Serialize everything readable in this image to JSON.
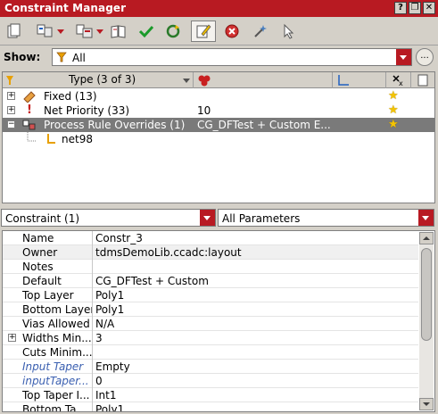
{
  "window": {
    "title": "Constraint Manager",
    "controls": [
      "?",
      "❐",
      "✕"
    ]
  },
  "toolbar": {
    "buttons": [
      {
        "name": "copy-icon"
      },
      {
        "name": "multi-copy-icon"
      },
      {
        "name": "layout-copy-icon"
      },
      {
        "name": "book-icon"
      },
      {
        "name": "check-icon"
      },
      {
        "name": "refresh-icon"
      },
      {
        "name": "edit-icon",
        "active": true
      },
      {
        "name": "stop-icon"
      },
      {
        "name": "wand-icon"
      },
      {
        "name": "pointer-icon"
      }
    ]
  },
  "show": {
    "label": "Show:",
    "value": "All",
    "more": "..."
  },
  "tree": {
    "header": {
      "type": "Type (3 of 3)"
    },
    "rows": [
      {
        "expander": "+",
        "label": "Fixed (13)",
        "value": "",
        "icon": "pin-icon",
        "star": true
      },
      {
        "expander": "+",
        "label": "Net Priority (33)",
        "value": "10",
        "icon": "exclamation-icon",
        "star": true
      },
      {
        "expander": "−",
        "label": "Process Rule Overrides (1)",
        "value": "CG_DFTest + Custom E...",
        "icon": "rule-icon",
        "star": true,
        "selected": true
      },
      {
        "expander": "",
        "label": "net98",
        "value": "",
        "icon": "net-icon",
        "star": false,
        "child": true
      }
    ]
  },
  "constraint_select": {
    "value": "Constraint (1)"
  },
  "param_select": {
    "value": "All Parameters"
  },
  "grid": {
    "rows": [
      {
        "key": "Name",
        "value": "Constr_3"
      },
      {
        "key": "Owner",
        "value": "tdmsDemoLib.ccadc:layout"
      },
      {
        "key": "Notes",
        "value": ""
      },
      {
        "key": "Default",
        "value": "CG_DFTest + Custom"
      },
      {
        "key": "Top Layer",
        "value": "Poly1"
      },
      {
        "key": "Bottom Layer",
        "value": "Poly1"
      },
      {
        "key": "Vias Allowed",
        "value": "N/A"
      },
      {
        "key": "Widths Min...",
        "value": "3",
        "expander": "+"
      },
      {
        "key": "Cuts Minim...",
        "value": ""
      },
      {
        "key": "Input Taper",
        "value": "Empty",
        "italic": true
      },
      {
        "key": "inputTaper...",
        "value": "0",
        "italic": true
      },
      {
        "key": "Top Taper I...",
        "value": "Int1"
      },
      {
        "key": "Bottom Ta...",
        "value": "Poly1"
      }
    ]
  },
  "colors": {
    "accent": "#b81a22",
    "selection": "#7a7a7a",
    "star": "#f4c400"
  }
}
